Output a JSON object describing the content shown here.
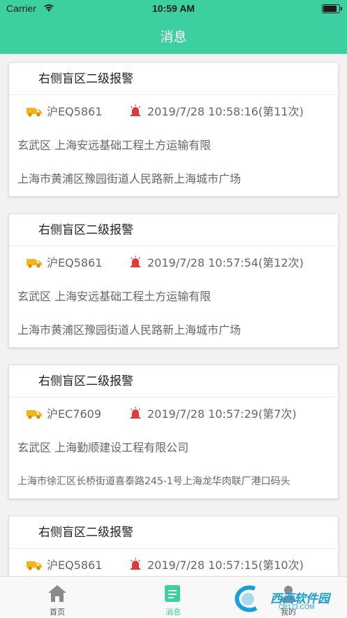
{
  "status_bar": {
    "carrier": "Carrier",
    "time": "10:59 AM"
  },
  "header": {
    "title": "消息"
  },
  "messages": [
    {
      "title": "右侧盲区二级报警",
      "plate": "沪EQ5861",
      "datetime": "2019/7/28 10:58:16(第11次)",
      "company": "玄武区 上海安远基础工程土方运输有限",
      "address": "上海市黄浦区豫园街道人民路新上海城市广场"
    },
    {
      "title": "右侧盲区二级报警",
      "plate": "沪EQ5861",
      "datetime": "2019/7/28 10:57:54(第12次)",
      "company": "玄武区 上海安远基础工程土方运输有限",
      "address": "上海市黄浦区豫园街道人民路新上海城市广场"
    },
    {
      "title": "右侧盲区二级报警",
      "plate": "沪EC7609",
      "datetime": "2019/7/28 10:57:29(第7次)",
      "company": "玄武区 上海勤顺建设工程有限公司",
      "address": "上海市徐汇区长桥街道喜泰路245-1号上海龙华肉联厂港口码头"
    },
    {
      "title": "右侧盲区二级报警",
      "plate": "沪EQ5861",
      "datetime": "2019/7/28 10:57:15(第10次)"
    }
  ],
  "tab_bar": {
    "tabs": [
      {
        "label": "首页",
        "icon": "home-icon",
        "active": false
      },
      {
        "label": "消息",
        "icon": "message-icon",
        "active": true
      },
      {
        "label": "我的",
        "icon": "profile-icon",
        "active": false
      }
    ]
  },
  "watermark": {
    "text": "西西软件园",
    "sub": "CR173.COM"
  },
  "colors": {
    "accent": "#3ccfa0",
    "alarm": "#e2383a",
    "truck": "#f5b51e"
  }
}
